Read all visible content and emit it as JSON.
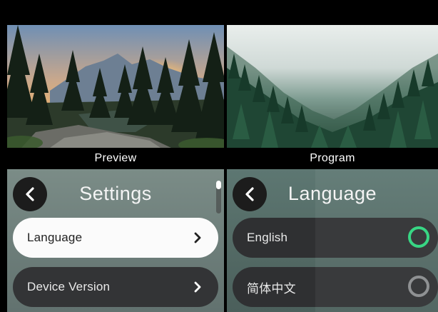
{
  "preview": {
    "caption": "Preview"
  },
  "program": {
    "caption": "Program"
  },
  "settings_menu": {
    "title": "Settings",
    "items": [
      {
        "label": "Language",
        "selected": true
      },
      {
        "label": "Device Version",
        "selected": false
      }
    ]
  },
  "language_menu": {
    "title": "Language",
    "options": [
      {
        "label": "English",
        "checked": true
      },
      {
        "label": "简体中文",
        "checked": false
      }
    ]
  },
  "colors": {
    "radio_checked": "#2ed47e",
    "radio_unchecked": "#8a8c8e",
    "item_light": "#fbfbfb",
    "item_dark": "#333436"
  }
}
